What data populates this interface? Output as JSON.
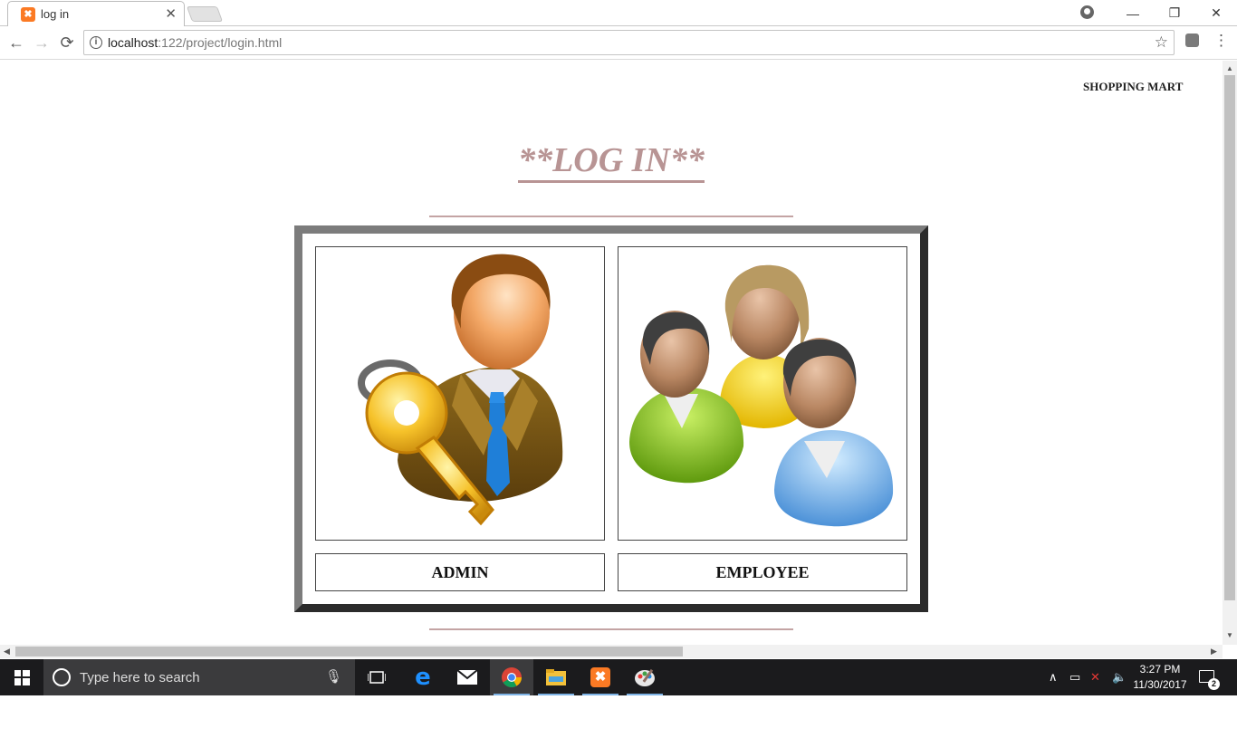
{
  "browser": {
    "tab_title": "log in",
    "tab_favicon": "xampp-icon",
    "url_host": "localhost",
    "url_path": ":122/project/login.html",
    "nav": {
      "back": "←",
      "forward": "→",
      "reload": "⟳"
    },
    "window_controls": {
      "minimize": "—",
      "restore": "❐",
      "close": "✕"
    }
  },
  "page": {
    "brand": "SHOPPING MART",
    "title": "**LOG IN**",
    "options": [
      {
        "label": "ADMIN",
        "icon": "admin-key-icon"
      },
      {
        "label": "EMPLOYEE",
        "icon": "employee-group-icon"
      }
    ],
    "colors": {
      "title": "#b89494",
      "rule": "#c4a4a4",
      "frame_dark": "#2b2b2b",
      "frame_light": "#7c7c7c"
    }
  },
  "taskbar": {
    "search_placeholder": "Type here to search",
    "apps": [
      "task-view-icon",
      "edge-icon",
      "mail-icon",
      "chrome-icon",
      "file-explorer-icon",
      "xampp-icon",
      "paint-icon"
    ],
    "time": "3:27 PM",
    "date": "11/30/2017",
    "notification_count": "2"
  }
}
